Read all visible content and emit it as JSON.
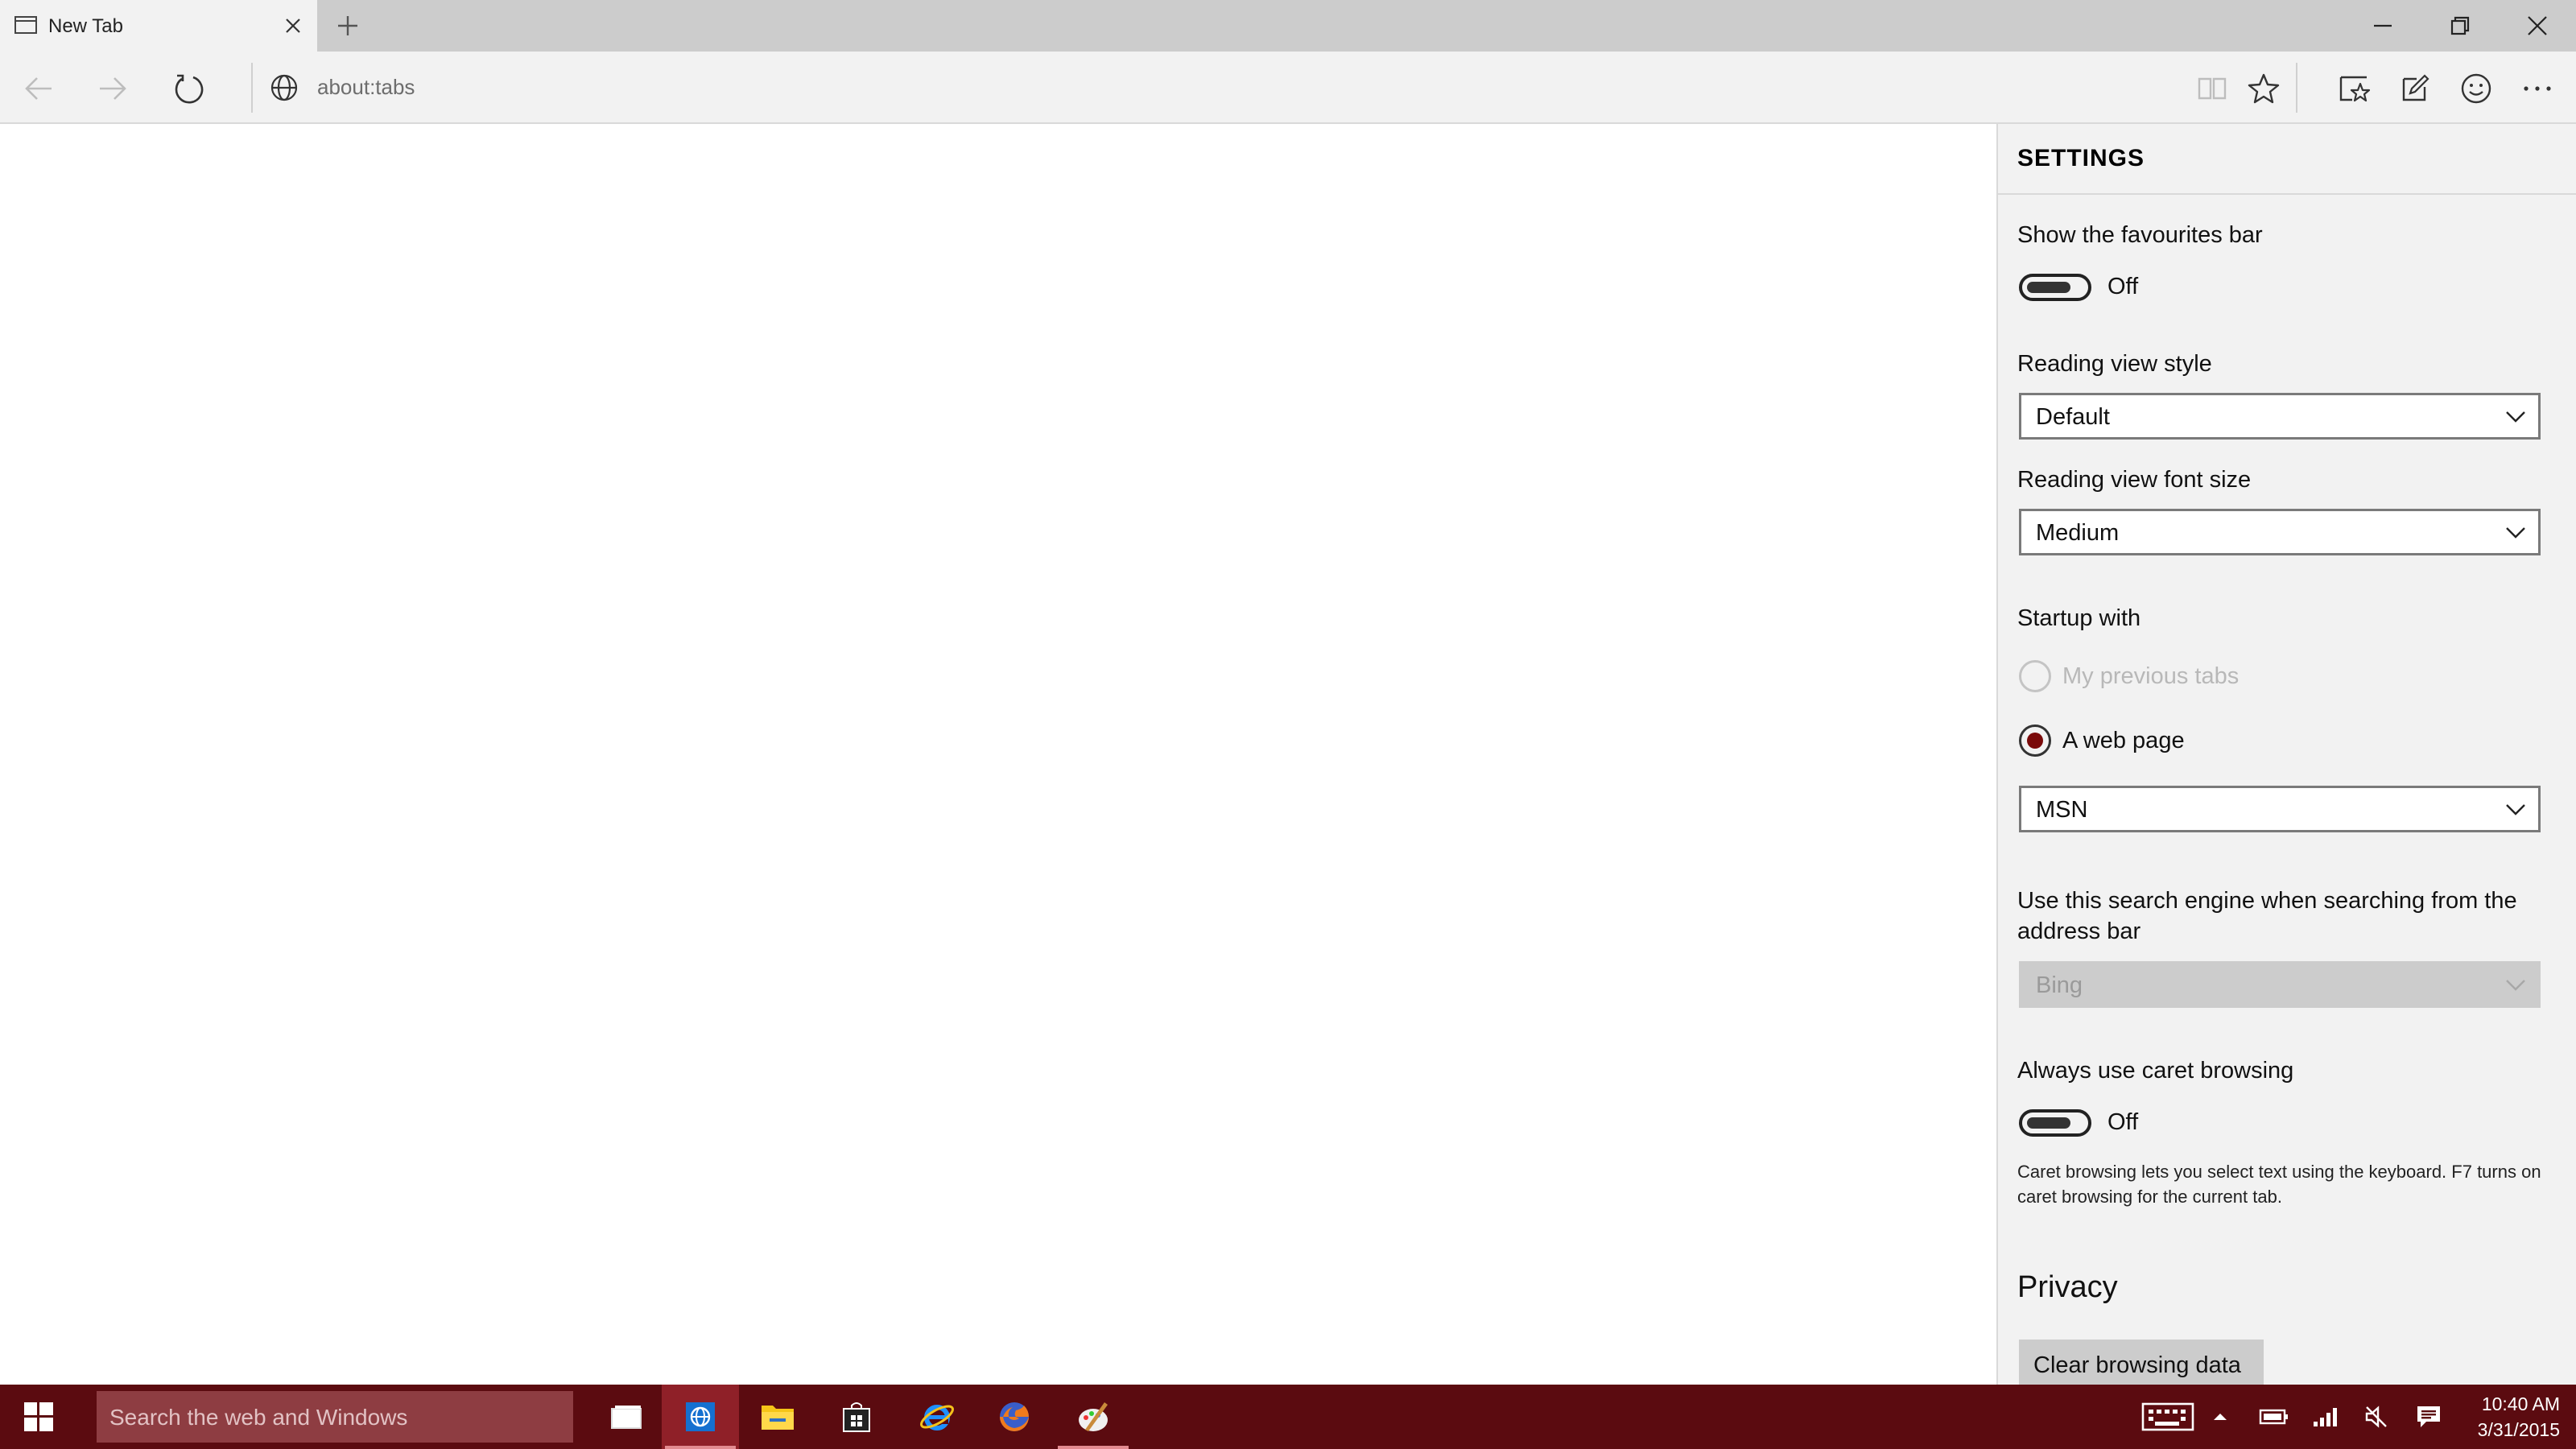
{
  "tab": {
    "title": "New Tab"
  },
  "address": {
    "url": "about:tabs"
  },
  "settings": {
    "heading": "SETTINGS",
    "favourites_bar": {
      "label": "Show the favourites bar",
      "state": "Off"
    },
    "reading_style": {
      "label": "Reading view style",
      "value": "Default"
    },
    "reading_font": {
      "label": "Reading view font size",
      "value": "Medium"
    },
    "startup": {
      "label": "Startup with",
      "option_previous": "My previous tabs",
      "option_webpage": "A web page",
      "page_value": "MSN"
    },
    "search_engine": {
      "label": "Use this search engine when searching from the address bar",
      "value": "Bing"
    },
    "caret": {
      "label": "Always use caret browsing",
      "state": "Off",
      "description": "Caret browsing lets you select text using the keyboard. F7 turns on caret browsing for the current tab."
    },
    "privacy": {
      "heading": "Privacy",
      "clear_button": "Clear browsing data"
    }
  },
  "taskbar": {
    "search_placeholder": "Search the web and Windows",
    "time": "10:40 AM",
    "date": "3/31/2015"
  },
  "colors": {
    "taskbar": "#5b0b10",
    "accent": "#7a0a0a",
    "pane": "#f2f2f2"
  }
}
